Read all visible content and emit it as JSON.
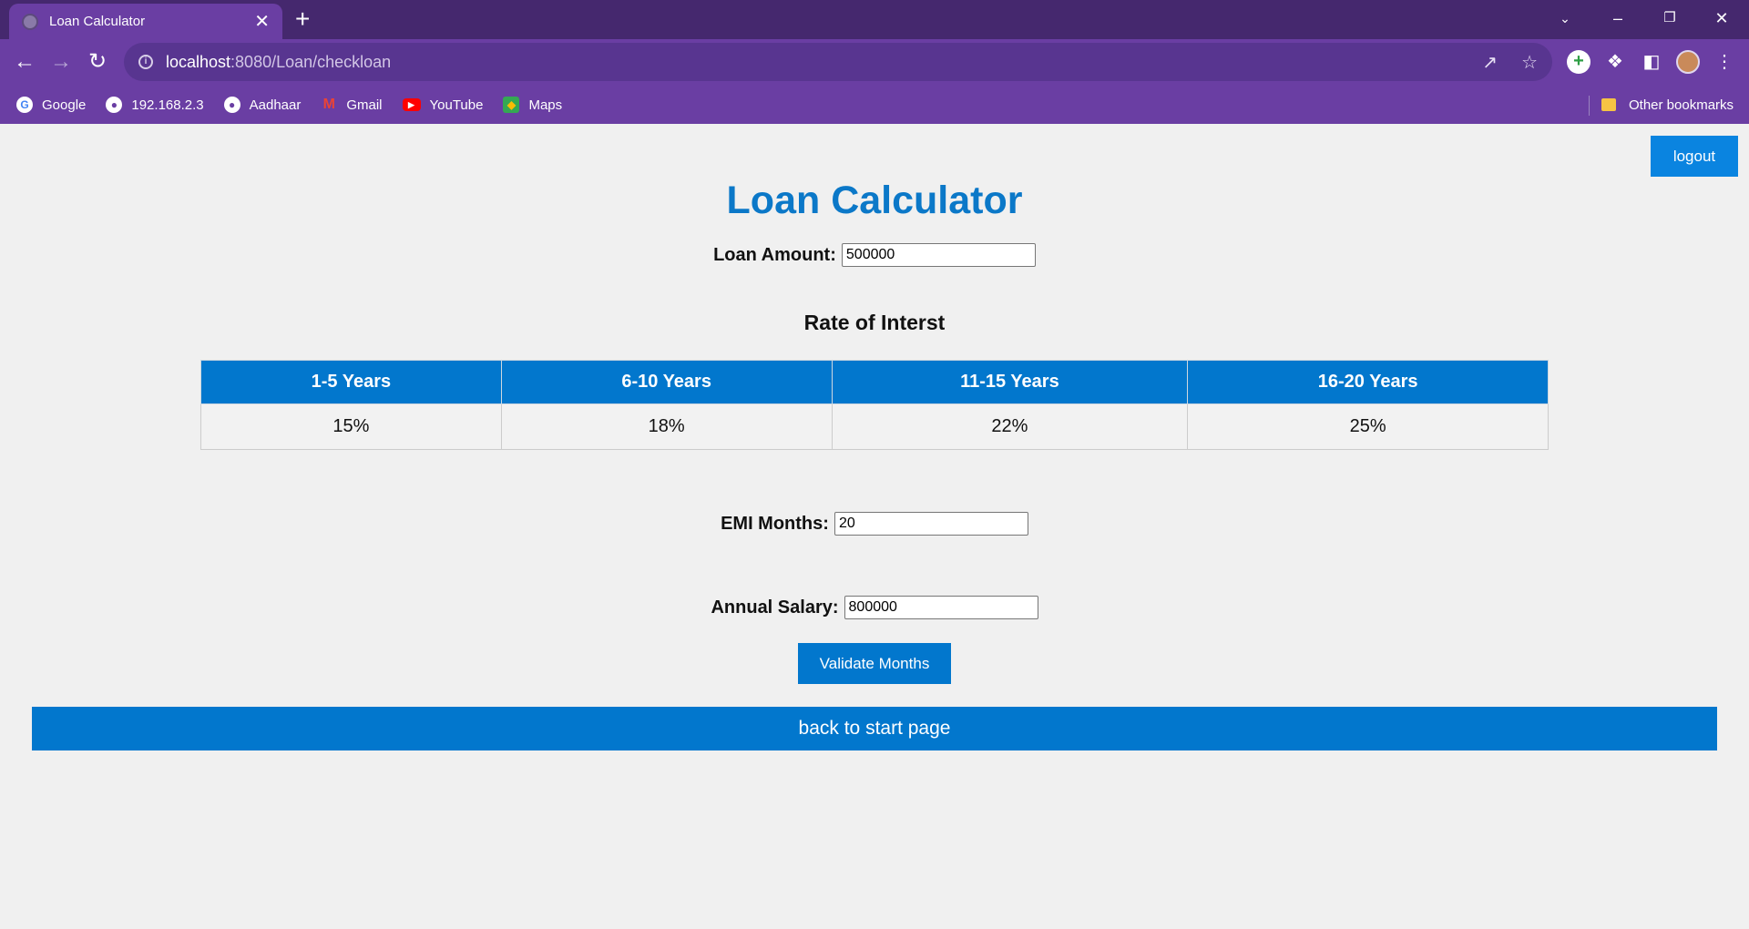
{
  "browser": {
    "tab_title": "Loan Calculator",
    "tab_close": "✕",
    "new_tab": "+",
    "url_host": "localhost",
    "url_path": ":8080/Loan/checkloan",
    "bookmarks": [
      {
        "label": "Google",
        "icon": "google-icon"
      },
      {
        "label": "192.168.2.3",
        "icon": "globe-icon"
      },
      {
        "label": "Aadhaar",
        "icon": "globe-icon"
      },
      {
        "label": "Gmail",
        "icon": "gmail-icon"
      },
      {
        "label": "YouTube",
        "icon": "youtube-icon"
      },
      {
        "label": "Maps",
        "icon": "maps-icon"
      }
    ],
    "other_bookmarks": "Other bookmarks"
  },
  "page": {
    "logout_label": "logout",
    "title": "Loan Calculator",
    "loan_amount_label": "Loan Amount:",
    "loan_amount_value": "500000",
    "rate_heading": "Rate of Interst",
    "rate_table": {
      "headers": [
        "1-5 Years",
        "6-10 Years",
        "11-15 Years",
        "16-20 Years"
      ],
      "rates": [
        "15%",
        "18%",
        "22%",
        "25%"
      ]
    },
    "emi_months_label": "EMI Months:",
    "emi_months_value": "20",
    "annual_salary_label": "Annual Salary:",
    "annual_salary_value": "800000",
    "validate_label": "Validate Months",
    "back_label": "back to start page"
  },
  "colors": {
    "accent": "#0277cd",
    "title": "#0b78c8",
    "browser_frame": "#6a3ea3"
  }
}
